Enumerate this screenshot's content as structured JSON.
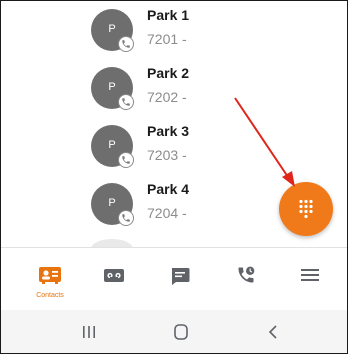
{
  "contacts": [
    {
      "initial": "P",
      "name": "Park 1",
      "ext": "7201 -"
    },
    {
      "initial": "P",
      "name": "Park 2",
      "ext": "7202 -"
    },
    {
      "initial": "P",
      "name": "Park 3",
      "ext": "7203 -"
    },
    {
      "initial": "P",
      "name": "Park 4",
      "ext": "7204 -"
    }
  ],
  "fab": {
    "icon": "dialpad-icon",
    "color": "#f07a1a"
  },
  "annotation": {
    "type": "arrow",
    "color": "#e0251b",
    "points_to": "dialpad-fab"
  },
  "tabbar": {
    "active_color": "#e8740f",
    "tabs": [
      {
        "icon": "contacts-icon",
        "label": "Contacts",
        "active": true
      },
      {
        "icon": "voicemail-icon",
        "label": "",
        "active": false
      },
      {
        "icon": "chat-icon",
        "label": "",
        "active": false
      },
      {
        "icon": "call-history-icon",
        "label": "",
        "active": false
      },
      {
        "icon": "menu-icon",
        "label": "",
        "active": false
      }
    ]
  },
  "system_nav": {
    "buttons": [
      {
        "icon": "recent-apps-icon"
      },
      {
        "icon": "home-icon"
      },
      {
        "icon": "back-icon"
      }
    ]
  }
}
